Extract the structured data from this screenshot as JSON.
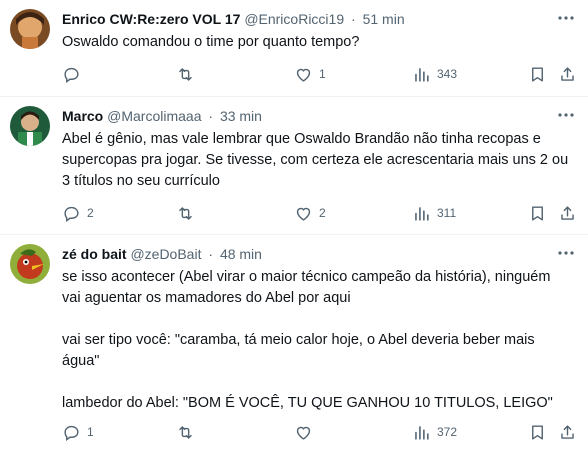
{
  "posts": [
    {
      "name": "Enrico CW:Re:zero VOL 17",
      "handle": "@EnricoRicci19",
      "separator": "·",
      "time": "51 min",
      "text": [
        "Oswaldo comandou o time por quanto tempo?"
      ],
      "replies": "",
      "retweets": "",
      "likes": "1",
      "views": "343"
    },
    {
      "name": "Marco",
      "handle": "@Marcolimaaa",
      "separator": "·",
      "time": "33 min",
      "text": [
        "Abel é gênio, mas vale lembrar que Oswaldo Brandão não tinha recopas e supercopas pra jogar. Se tivesse, com certeza ele acrescentaria mais uns 2 ou 3 títulos no seu currículo"
      ],
      "replies": "2",
      "retweets": "",
      "likes": "2",
      "views": "311"
    },
    {
      "name": "zé do bait",
      "handle": "@zeDoBait",
      "separator": "·",
      "time": "48 min",
      "text_p1": "se isso acontecer (Abel virar o maior técnico campeão da história), ninguém vai aguentar os mamadores do Abel por aqui",
      "text_p2": "vai ser tipo  você: \"caramba, tá meio calor hoje, o Abel deveria beber mais água\"",
      "text_p3": "lambedor do Abel: \"BOM É VOCÊ, TU QUE GANHOU 10 TITULOS, LEIGO\"",
      "replies": "1",
      "retweets": "",
      "likes": "",
      "views": "372"
    }
  ],
  "icons": {
    "reply": "reply-icon",
    "retweet": "retweet-icon",
    "like": "heart-icon",
    "views": "views-icon",
    "bookmark": "bookmark-icon",
    "share": "share-icon",
    "more": "more-icon"
  },
  "colors": {
    "muted": "#536471",
    "text": "#0f1419",
    "divider": "#eff3f4"
  }
}
